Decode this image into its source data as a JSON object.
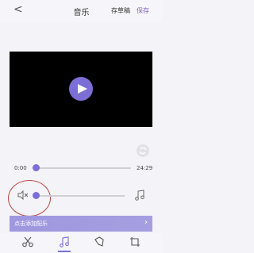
{
  "header": {
    "back_glyph": "<",
    "title": "音乐",
    "draft_label": "存草稿",
    "save_label": "保存"
  },
  "player": {
    "current_time": "0:00",
    "total_time": "24:29",
    "progress_fraction": 0.0,
    "volume_fraction": 0.0
  },
  "banner": {
    "text": "点击添加配乐",
    "arrow": "›"
  },
  "colors": {
    "accent": "#7b6fd6",
    "save": "#7a62c4",
    "annotation_circle": "#b8473e"
  },
  "bottom_tabs": [
    {
      "icon": "scissors-icon"
    },
    {
      "icon": "music-note-icon",
      "active": true
    },
    {
      "icon": "sticker-icon"
    },
    {
      "icon": "crop-icon"
    }
  ]
}
